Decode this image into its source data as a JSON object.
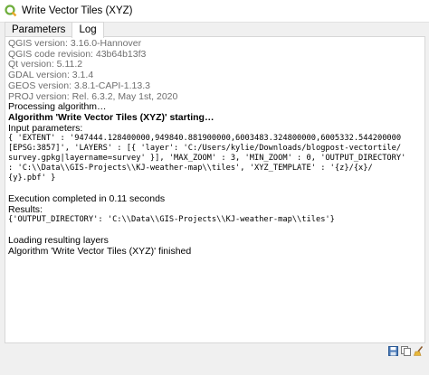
{
  "window": {
    "title": "Write Vector Tiles (XYZ)"
  },
  "tabs": [
    {
      "label": "Parameters",
      "active": false
    },
    {
      "label": "Log",
      "active": true
    }
  ],
  "log": {
    "qgis_version": "QGIS version: 3.16.0-Hannover",
    "code_revision": "QGIS code revision: 43b64b13f3",
    "qt_version": "Qt version: 5.11.2",
    "gdal_version": "GDAL version: 3.1.4",
    "geos_version": "GEOS version: 3.8.1-CAPI-1.13.3",
    "proj_version": "PROJ version: Rel. 6.3.2, May 1st, 2020",
    "processing": "Processing algorithm…",
    "algorithm_start": "Algorithm 'Write Vector Tiles (XYZ)' starting…",
    "input_params_label": "Input parameters:",
    "params_1": "{ 'EXTENT' : '947444.128400000,949840.881900000,6003483.324800000,6005332.544200000",
    "params_2": "[EPSG:3857]', 'LAYERS' : [{ 'layer': 'C:/Users/kylie/Downloads/blogpost-vectortile/",
    "params_3": "survey.gpkg|layername=survey' }], 'MAX_ZOOM' : 3, 'MIN_ZOOM' : 0, 'OUTPUT_DIRECTORY'",
    "params_4": ": 'C:\\\\Data\\\\GIS-Projects\\\\KJ-weather-map\\\\tiles', 'XYZ_TEMPLATE' : '{z}/{x}/",
    "params_5": "{y}.pbf' }",
    "execution": "Execution completed in 0.11 seconds",
    "results_label": "Results:",
    "results_value": "{'OUTPUT_DIRECTORY': 'C:\\\\Data\\\\GIS-Projects\\\\KJ-weather-map\\\\tiles'}",
    "loading": "Loading resulting layers",
    "finished": "Algorithm 'Write Vector Tiles (XYZ)' finished"
  },
  "icons": [
    "qgis-logo-icon",
    "save-log-icon",
    "copy-log-icon",
    "clear-log-icon"
  ]
}
